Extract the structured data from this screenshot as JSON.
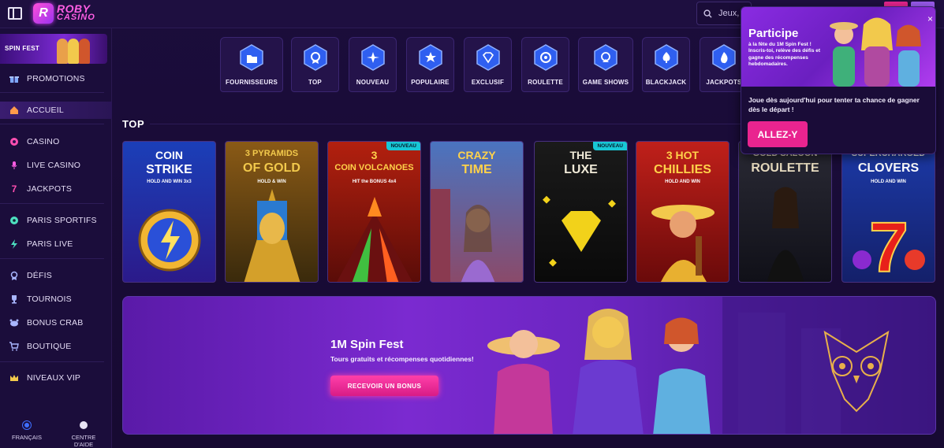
{
  "header": {
    "logo_line1": "ROBY",
    "logo_line2": "CASINO",
    "logo_badge": "R",
    "search_placeholder": "Jeux,"
  },
  "sidebar": {
    "promo_banner": "SPIN FEST",
    "items": [
      {
        "label": "PROMOTIONS",
        "icon": "gift-icon"
      },
      {
        "label": "ACCUEIL",
        "icon": "home-icon",
        "active": true
      },
      {
        "label": "CASINO",
        "icon": "casino-chip-icon"
      },
      {
        "label": "LIVE CASINO",
        "icon": "microphone-icon"
      },
      {
        "label": "JACKPOTS",
        "icon": "seven-icon"
      },
      {
        "label": "PARIS SPORTIFS",
        "icon": "soccer-ball-icon"
      },
      {
        "label": "PARIS LIVE",
        "icon": "lightning-icon"
      },
      {
        "label": "DÉFIS",
        "icon": "medal-icon"
      },
      {
        "label": "TOURNOIS",
        "icon": "trophy-icon"
      },
      {
        "label": "BONUS CRAB",
        "icon": "crab-icon"
      },
      {
        "label": "BOUTIQUE",
        "icon": "cart-icon"
      },
      {
        "label": "NIVEAUX VIP",
        "icon": "crown-icon"
      }
    ],
    "footer": {
      "language": "FRANÇAIS",
      "help": "CENTRE D'AIDE"
    }
  },
  "categories": [
    {
      "label": "FOURNISSEURS",
      "icon": "folder-icon"
    },
    {
      "label": "TOP",
      "icon": "award-icon"
    },
    {
      "label": "NOUVEAU",
      "icon": "sparkle-icon"
    },
    {
      "label": "POPULAIRE",
      "icon": "star-icon"
    },
    {
      "label": "EXCLUSIF",
      "icon": "diamond-icon"
    },
    {
      "label": "ROULETTE",
      "icon": "roulette-icon"
    },
    {
      "label": "GAME SHOWS",
      "icon": "wheel-icon"
    },
    {
      "label": "BLACKJACK",
      "icon": "spade-icon"
    },
    {
      "label": "JACKPOTS",
      "icon": "flame-icon"
    }
  ],
  "section_title": "TOP",
  "games": [
    {
      "title1": "COIN",
      "title2": "STRIKE",
      "sub": "HOLD AND WIN 3x3",
      "badge": "",
      "bg1": "#1b3fb8",
      "bg2": "#2b1a8a"
    },
    {
      "title1": "3 PYRAMIDS",
      "title2": "OF GOLD",
      "sub": "HOLD & WIN",
      "badge": "",
      "bg1": "#8a5a16",
      "bg2": "#3a2a0c"
    },
    {
      "title1": "3",
      "title2": "COIN VOLCANOES",
      "sub": "HIT the BONUS 4x4",
      "badge": "NOUVEAU",
      "bg1": "#b3200f",
      "bg2": "#5a0c08"
    },
    {
      "title1": "CRAZY",
      "title2": "TIME",
      "sub": "",
      "badge": "",
      "bg1": "#4a74c0",
      "bg2": "#8a4a6a"
    },
    {
      "title1": "THE",
      "title2": "LUXE",
      "sub": "",
      "badge": "NOUVEAU",
      "bg1": "#1a1a1a",
      "bg2": "#0a0a0a"
    },
    {
      "title1": "3 HOT",
      "title2": "CHILLIES",
      "sub": "HOLD AND WIN",
      "badge": "",
      "bg1": "#c0201a",
      "bg2": "#6a0a0a"
    },
    {
      "title1": "GOLD SALOON",
      "title2": "ROULETTE",
      "sub": "",
      "badge": "",
      "bg1": "#2a2a35",
      "bg2": "#101018"
    },
    {
      "title1": "SUPERCHARGED",
      "title2": "CLOVERS",
      "sub": "HOLD AND WIN",
      "badge": "",
      "bg1": "#1c3aa8",
      "bg2": "#14206a"
    }
  ],
  "hero": {
    "title": "1M Spin Fest",
    "subtitle": "Tours gratuits et récompenses quotidiennes!",
    "button": "RECEVOIR UN BONUS"
  },
  "popup": {
    "title": "Participe",
    "desc": "à la fête du 1M Spin Fest ! Inscris-toi, relève des défis et gagne des récompenses hebdomadaires.",
    "body": "Joue dès aujourd'hui pour tenter ta chance de gagner dès le départ !",
    "button": "ALLEZ-Y",
    "close": "×"
  },
  "colors": {
    "accent_pink": "#e9248f",
    "bg_dark": "#1b0d3b",
    "badge_cyan": "#18c7d6"
  }
}
